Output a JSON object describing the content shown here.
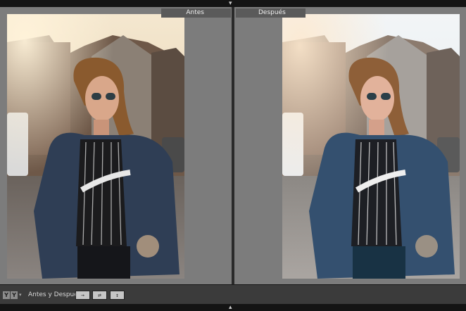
{
  "panes": {
    "before_label": "Antes",
    "after_label": "Después"
  },
  "toolbar": {
    "view_icon_left": "Y",
    "view_icon_right": "Y",
    "caret": "▾",
    "label": "Antes y Después:",
    "btn_left_right": "→",
    "btn_swap": "⇄",
    "btn_copy": "↕"
  },
  "chrome": {
    "top_arrow": "▾",
    "bottom_arrow": "▴"
  },
  "icons": {
    "view_mode": "before-after-view-icon",
    "top_panel_toggle": "triangle-down-icon",
    "bottom_panel_toggle": "triangle-up-icon"
  }
}
